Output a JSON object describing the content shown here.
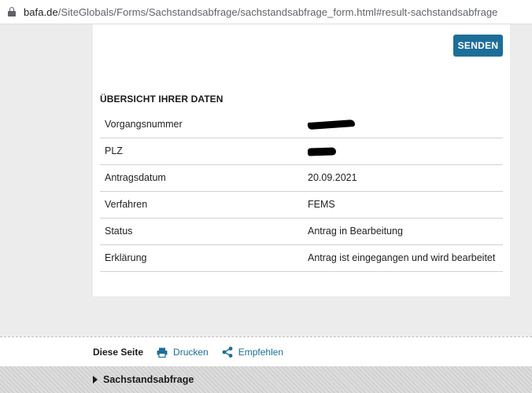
{
  "browser": {
    "url_domain": "bafa.de",
    "url_path": "/SiteGlobals/Forms/Sachstandsabfrage/sachstandsabfrage_form.html#result-sachstandsabfrage"
  },
  "form": {
    "send_label": "SENDEN"
  },
  "overview": {
    "title": "ÜBERSICHT IHRER DATEN",
    "rows": [
      {
        "label": "Vorgangsnummer",
        "value": ""
      },
      {
        "label": "PLZ",
        "value": ""
      },
      {
        "label": "Antragsdatum",
        "value": "20.09.2021"
      },
      {
        "label": "Verfahren",
        "value": "FEMS"
      },
      {
        "label": "Status",
        "value": "Antrag in Bearbeitung"
      },
      {
        "label": "Erklärung",
        "value": "Antrag ist eingegangen und wird bearbeitet"
      }
    ]
  },
  "footer": {
    "label": "Diese Seite",
    "print_label": "Drucken",
    "recommend_label": "Empfehlen"
  },
  "breadcrumb": {
    "label": "Sachstandsabfrage"
  },
  "colors": {
    "accent": "#1c6e99",
    "page_bg": "#ececec"
  }
}
